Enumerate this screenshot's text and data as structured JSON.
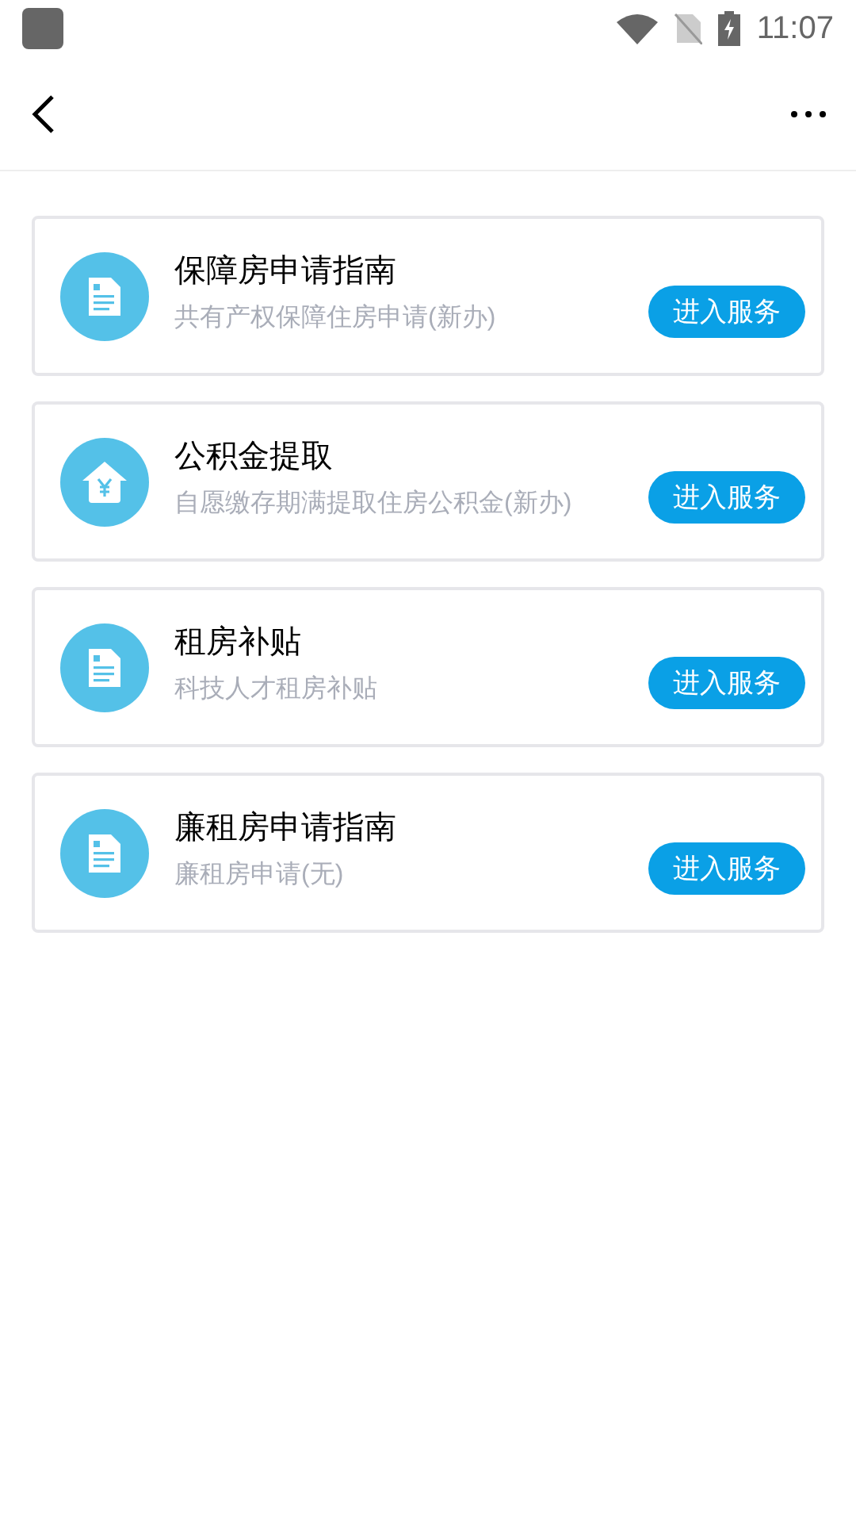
{
  "status_bar": {
    "time": "11:07"
  },
  "services": [
    {
      "kind": "document",
      "title": "保障房申请指南",
      "subtitle": "共有产权保障住房申请(新办)",
      "button": "进入服务"
    },
    {
      "kind": "house",
      "title": "公积金提取",
      "subtitle": "自愿缴存期满提取住房公积金(新办)",
      "button": "进入服务"
    },
    {
      "kind": "document",
      "title": "租房补贴",
      "subtitle": "科技人才租房补贴",
      "button": "进入服务"
    },
    {
      "kind": "document",
      "title": "廉租房申请指南",
      "subtitle": "廉租房申请(无)",
      "button": "进入服务"
    }
  ]
}
